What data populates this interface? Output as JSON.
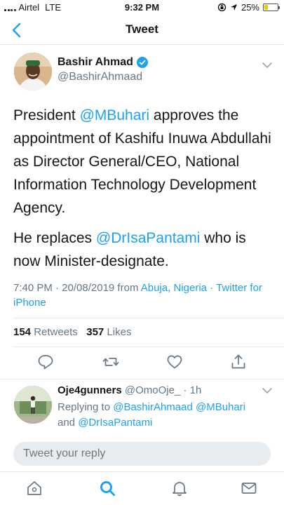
{
  "status_bar": {
    "carrier": "Airtel",
    "network": "LTE",
    "time": "9:32 PM",
    "battery": "25%",
    "battery_level": 0.25,
    "battery_color": "#f5c400"
  },
  "nav": {
    "back_icon": "chevron-left-icon",
    "title": "Tweet"
  },
  "tweet": {
    "author_name": "Bashir Ahmad",
    "author_handle": "@BashirAhmaad",
    "verified": true,
    "text": {
      "p1_before": "President ",
      "p1_mention": "@MBuhari",
      "p1_after": " approves the appointment of Kashifu Inuwa Abdullahi as Director General/CEO, National Information Technology Development Agency.",
      "p2_before": "He replaces ",
      "p2_mention": "@DrIsaPantami",
      "p2_after": " who is now Minister-designate."
    },
    "meta": {
      "time_date": "7:40 PM · 20/08/2019 from ",
      "location": "Abuja, Nigeria",
      "separator": " · ",
      "client": "Twitter for iPhone"
    },
    "stats": {
      "retweets_count": "154",
      "retweets_label": "Retweets",
      "likes_count": "357",
      "likes_label": "Likes"
    },
    "actions": [
      "reply-icon",
      "retweet-icon",
      "like-icon",
      "share-icon"
    ]
  },
  "reply": {
    "name": "Oje4gunners",
    "handle": "@OmoOje_",
    "time": " · 1h",
    "replying_to_label": "Replying to ",
    "mention1": "@BashirAhmaad",
    "mention2": "@MBuhari",
    "and_label": "and ",
    "mention3": "@DrIsaPantami"
  },
  "composer": {
    "placeholder": "Tweet your reply"
  },
  "tabbar": {
    "tabs": [
      "home-icon",
      "search-icon",
      "notifications-icon",
      "messages-icon"
    ],
    "active": "search-icon"
  },
  "colors": {
    "accent": "#1da1f2",
    "text": "#14171a",
    "secondary": "#657786",
    "border": "#e1e8ed"
  }
}
